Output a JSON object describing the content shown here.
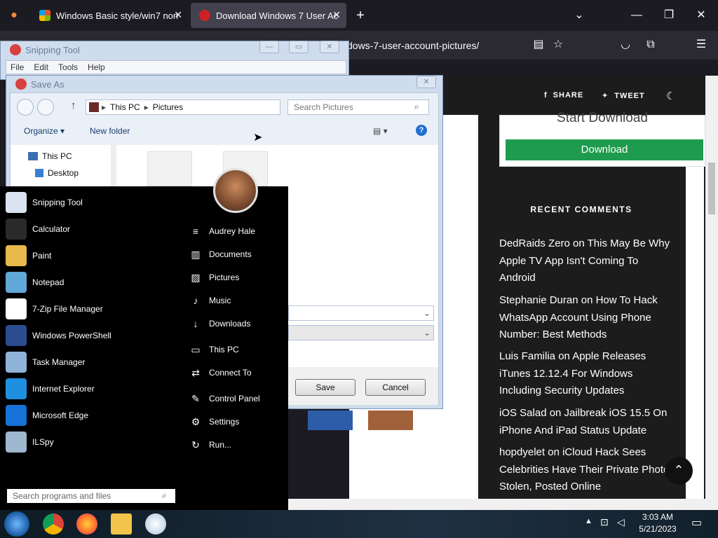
{
  "browser": {
    "tabs": [
      {
        "label": "Windows Basic style/win7 non"
      },
      {
        "label": "Download Windows 7 User Ac"
      }
    ],
    "new_tab": "+",
    "url": "dows-7-user-account-pictures/"
  },
  "webpage": {
    "share": "SHARE",
    "tweet": "TWEET",
    "download_box_title": "Start Download",
    "download_button": "Download",
    "recent_comments_title": "RECENT COMMENTS",
    "comments": [
      {
        "text": "DedRaids Zero on This May Be Why Apple TV App Isn't Coming To Android"
      },
      {
        "text": "Stephanie Duran on How To Hack WhatsApp Account Using Phone Number: Best Methods"
      },
      {
        "text": "Luis Familia on Apple Releases iTunes 12.12.4 For Windows Including Security Updates"
      },
      {
        "text": "iOS Salad on Jailbreak iOS 15.5 On iPhone And iPad Status Update"
      },
      {
        "text": "hopdyelet on iCloud Hack Sees Celebrities Have Their Private Photos Stolen, Posted Online"
      }
    ]
  },
  "snipping_tool": {
    "title": "Snipping Tool",
    "menu": [
      "File",
      "Edit",
      "Tools",
      "Help"
    ]
  },
  "save_as": {
    "title": "Save As",
    "breadcrumb": [
      "This PC",
      "Pictures"
    ],
    "search_placeholder": "Search Pictures",
    "organize": "Organize",
    "new_folder": "New folder",
    "tree": [
      "This PC",
      "Desktop"
    ],
    "save_button": "Save",
    "cancel_button": "Cancel"
  },
  "start_menu": {
    "programs": [
      {
        "label": "Snipping Tool",
        "color": "#d9e4f0"
      },
      {
        "label": "Calculator",
        "color": "#2a2a2a"
      },
      {
        "label": "Paint",
        "color": "#e8b84a"
      },
      {
        "label": "Notepad",
        "color": "#5fa8d8"
      },
      {
        "label": "7-Zip File Manager",
        "color": "#ffffff"
      },
      {
        "label": "Windows PowerShell",
        "color": "#2a4d8f"
      },
      {
        "label": "Task Manager",
        "color": "#8fb3d6"
      },
      {
        "label": "Internet Explorer",
        "color": "#1f8fe0"
      },
      {
        "label": "Microsoft Edge",
        "color": "#1572d6"
      },
      {
        "label": "ILSpy",
        "color": "#9fb7cf"
      }
    ],
    "places": [
      {
        "label": "Audrey Hale",
        "icon": "≡"
      },
      {
        "label": "Documents",
        "icon": "▥"
      },
      {
        "label": "Pictures",
        "icon": "▨"
      },
      {
        "label": "Music",
        "icon": "♪"
      },
      {
        "label": "Downloads",
        "icon": "↓"
      },
      {
        "label": "This PC",
        "icon": "▭"
      },
      {
        "label": "Connect To",
        "icon": "⇄"
      },
      {
        "label": "Control Panel",
        "icon": "✎"
      },
      {
        "label": "Settings",
        "icon": "⚙"
      },
      {
        "label": "Run...",
        "icon": "↻"
      }
    ],
    "search_placeholder": "Search programs and files"
  },
  "taskbar": {
    "time": "3:03 AM",
    "date": "5/21/2023"
  }
}
